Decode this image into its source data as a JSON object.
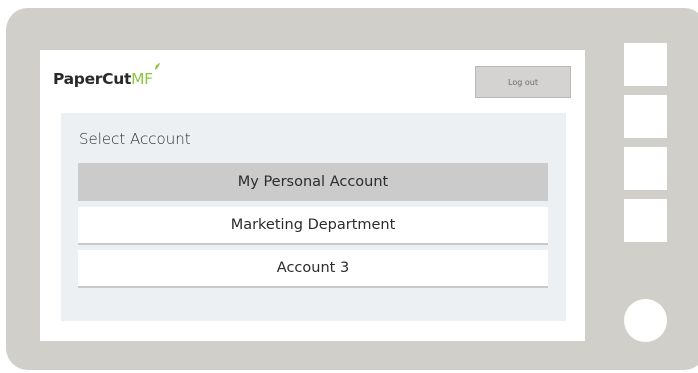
{
  "brand": {
    "name_dark": "PaperCut",
    "name_accent": "MF"
  },
  "header": {
    "logout_label": "Log out"
  },
  "account_panel": {
    "title": "Select Account",
    "accounts": [
      {
        "label": "My Personal Account",
        "selected": true
      },
      {
        "label": "Marketing Department",
        "selected": false
      },
      {
        "label": "Account 3",
        "selected": false
      }
    ]
  },
  "colors": {
    "device_body": "#d1cfc9",
    "panel_bg": "#edf0f3",
    "selected_row": "#cbcbcb",
    "brand_accent": "#8cc63f"
  }
}
